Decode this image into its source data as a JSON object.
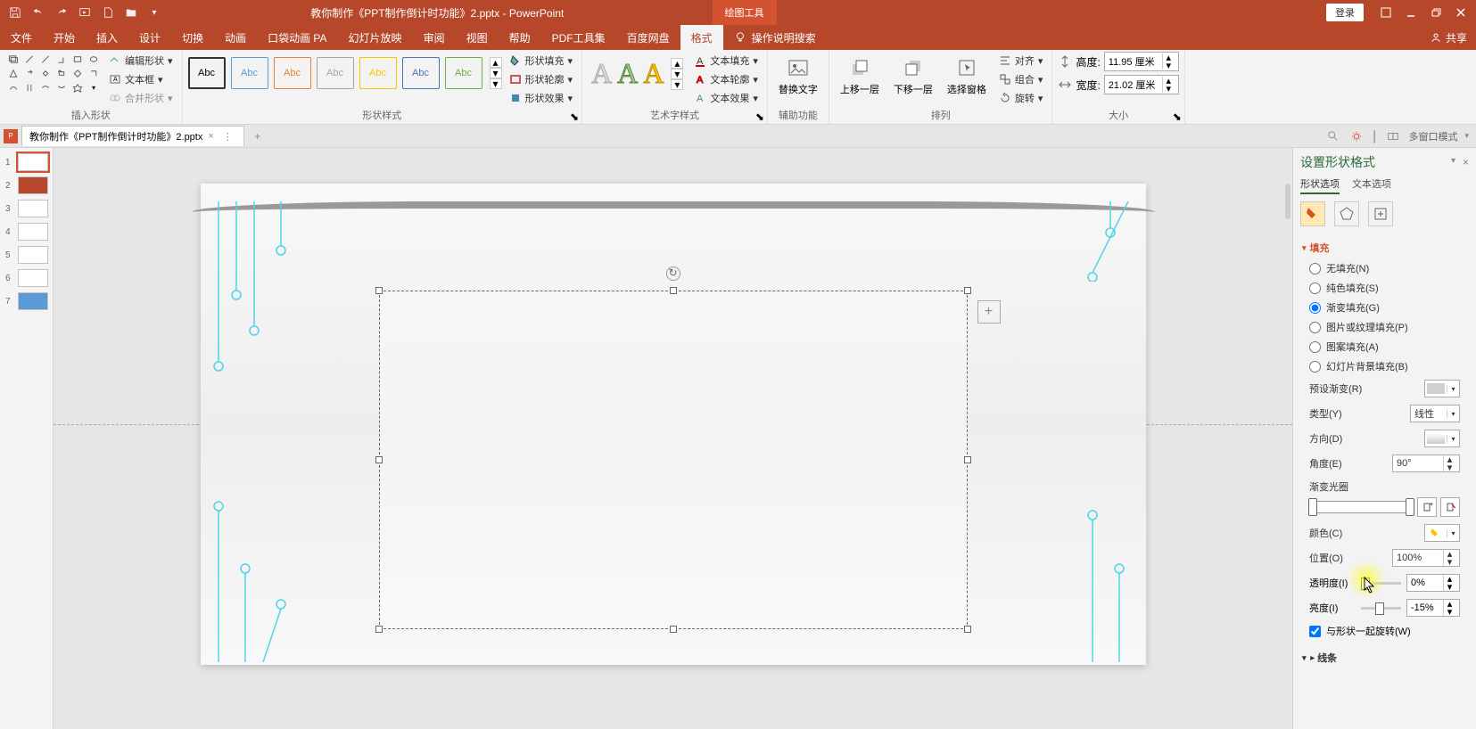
{
  "titlebar": {
    "doc_title": "教你制作《PPT制作倒计时功能》2.pptx - PowerPoint",
    "context_tool": "绘图工具",
    "login": "登录"
  },
  "tabs": {
    "items": [
      "文件",
      "开始",
      "插入",
      "设计",
      "切换",
      "动画",
      "口袋动画 PA",
      "幻灯片放映",
      "审阅",
      "视图",
      "帮助",
      "PDF工具集",
      "百度网盘",
      "格式"
    ],
    "active": "格式",
    "tellme": "操作说明搜索",
    "share": "共享"
  },
  "ribbon": {
    "groups": {
      "insert_shapes": "插入形状",
      "shape_styles": "形状样式",
      "wordart_styles": "艺术字样式",
      "a11y": "辅助功能",
      "arrange": "排列",
      "size": "大小"
    },
    "edit_shape": "编辑形状",
    "textbox": "文本框",
    "merge_shapes": "合并形状",
    "shape_fill": "形状填充",
    "shape_outline": "形状轮廓",
    "shape_effects": "形状效果",
    "text_fill": "文本填充",
    "text_outline": "文本轮廓",
    "text_effects": "文本效果",
    "alt_text": "替换文字",
    "bring_forward": "上移一层",
    "send_backward": "下移一层",
    "selection_pane": "选择窗格",
    "align": "对齐",
    "group": "组合",
    "rotate": "旋转",
    "height_label": "高度:",
    "width_label": "宽度:",
    "height_val": "11.95 厘米",
    "width_val": "21.02 厘米",
    "abc": "Abc"
  },
  "doc_tab": {
    "name": "教你制作《PPT制作倒计时功能》2.pptx",
    "multi_window": "多窗口模式"
  },
  "thumbs": [
    {
      "n": "1"
    },
    {
      "n": "2"
    },
    {
      "n": "3"
    },
    {
      "n": "4"
    },
    {
      "n": "5"
    },
    {
      "n": "6"
    },
    {
      "n": "7"
    }
  ],
  "pane": {
    "title": "设置形状格式",
    "tab_shape": "形状选项",
    "tab_text": "文本选项",
    "section_fill": "填充",
    "section_line": "线条",
    "fill_none": "无填充(N)",
    "fill_solid": "纯色填充(S)",
    "fill_gradient": "渐变填充(G)",
    "fill_picture": "图片或纹理填充(P)",
    "fill_pattern": "图案填充(A)",
    "fill_slidebg": "幻灯片背景填充(B)",
    "preset_gradient": "预设渐变(R)",
    "type": "类型(Y)",
    "type_val": "线性",
    "direction": "方向(D)",
    "angle": "角度(E)",
    "angle_val": "90°",
    "gradient_stops": "渐变光圈",
    "color": "颜色(C)",
    "position": "位置(O)",
    "position_val": "100%",
    "transparency": "透明度(I)",
    "transparency_val": "0%",
    "brightness": "亮度(I)",
    "brightness_val": "-15%",
    "rotate_with_shape": "与形状一起旋转(W)"
  }
}
